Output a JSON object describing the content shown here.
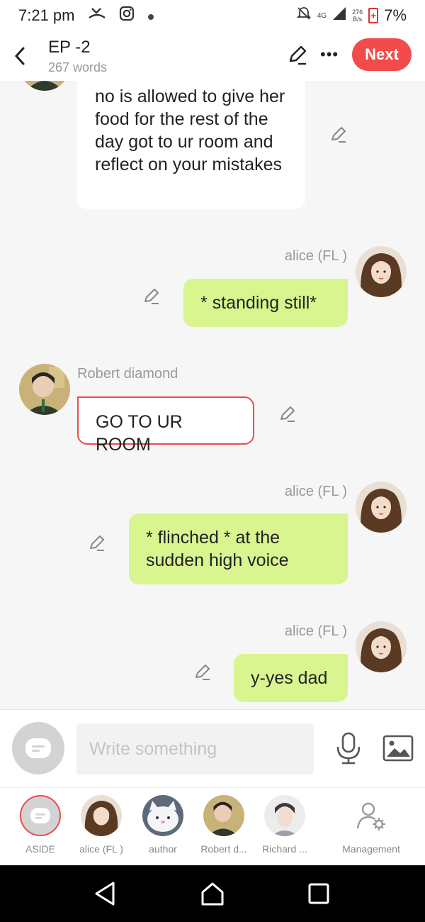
{
  "status": {
    "time": "7:21 pm",
    "net_type": "4G",
    "speed_value": "276",
    "speed_unit": "B/s",
    "battery": "7%"
  },
  "header": {
    "title": "EP -2",
    "word_count": "267 words",
    "next_label": "Next"
  },
  "messages": [
    {
      "side": "left",
      "sender": "",
      "text": "no is allowed to give her food for the rest of the day got to ur room and reflect on your mistakes"
    },
    {
      "side": "right",
      "sender": "alice (FL )",
      "text": "* standing still*"
    },
    {
      "side": "left",
      "sender": "Robert diamond",
      "text": "GO TO UR ROOM",
      "highlighted": true
    },
    {
      "side": "right",
      "sender": "alice (FL )",
      "text": "* flinched * at the sudden high voice"
    },
    {
      "side": "right",
      "sender": "alice (FL )",
      "text": "y-yes dad"
    }
  ],
  "composer": {
    "placeholder": "Write something"
  },
  "roles": [
    {
      "label": "ASIDE",
      "icon": "chat-bubble-icon",
      "selected": true
    },
    {
      "label": "alice (FL )",
      "icon": "avatar"
    },
    {
      "label": "author",
      "icon": "avatar"
    },
    {
      "label": "Robert d...",
      "icon": "avatar"
    },
    {
      "label": "Richard ...",
      "icon": "avatar"
    },
    {
      "label": "Management",
      "icon": "people-settings-icon"
    }
  ],
  "colors": {
    "accent": "#f24b4b",
    "outgoing_bubble": "#d9f58f",
    "incoming_bubble": "#ffffff",
    "background": "#f6f6f6"
  }
}
